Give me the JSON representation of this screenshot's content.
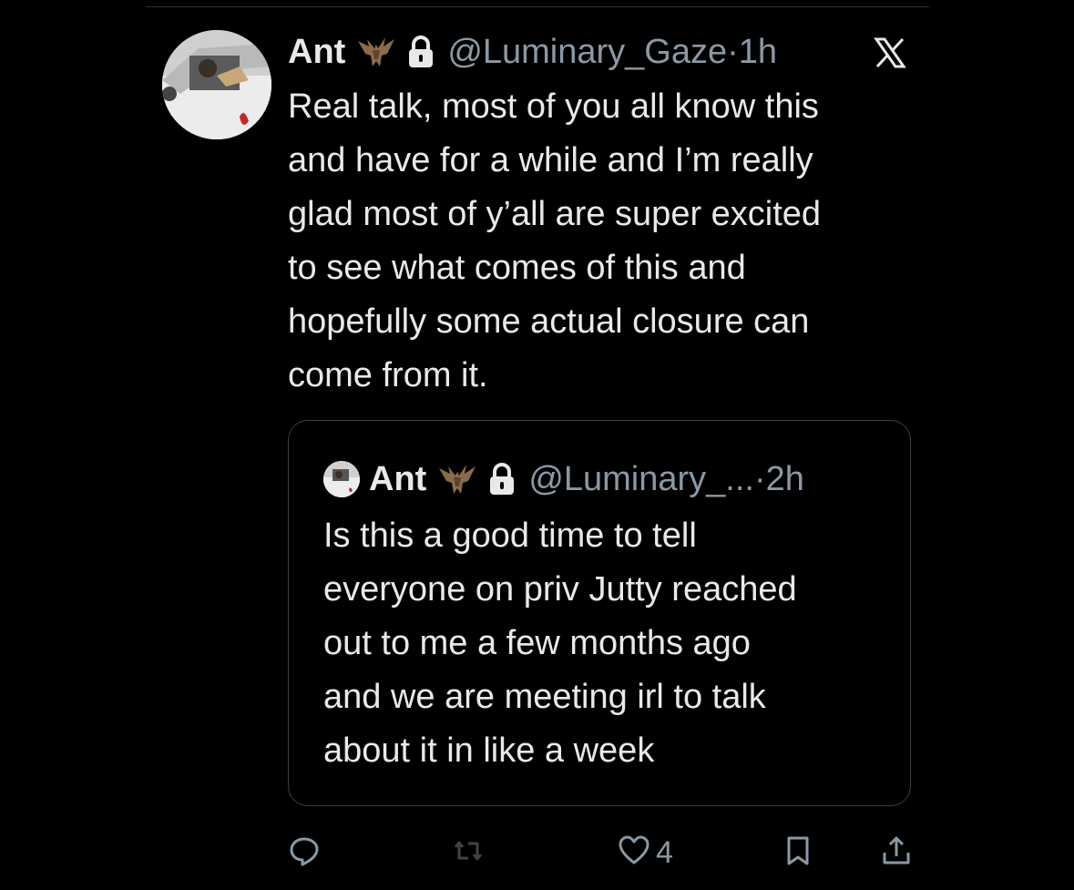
{
  "tweet": {
    "author_name": "Ant",
    "handle": "@Luminary_Gaze",
    "time": "·1h",
    "text": "Real talk, most of you all know this\nand have for a while and I’m really\nglad most of y’all are super excited\nto see what comes of this and\nhopefully some actual closure can\ncome from it."
  },
  "quote": {
    "author_name": "Ant",
    "handle": "@Luminary_...",
    "time": "·2h",
    "text": "Is this a good time to tell\neveryone on priv Jutty reached\nout to me a few months ago\nand we are meeting irl to talk\nabout it in like a week"
  },
  "actions": {
    "like_count": "4"
  },
  "colors": {
    "background": "#000000",
    "text": "#e7e9ea",
    "muted": "#8b98a5",
    "border": "#3a3f43"
  },
  "icons": [
    "bat-emoji-icon",
    "lock-icon",
    "x-logo-icon",
    "reply-icon",
    "retweet-icon",
    "heart-icon",
    "bookmark-icon",
    "share-icon"
  ]
}
